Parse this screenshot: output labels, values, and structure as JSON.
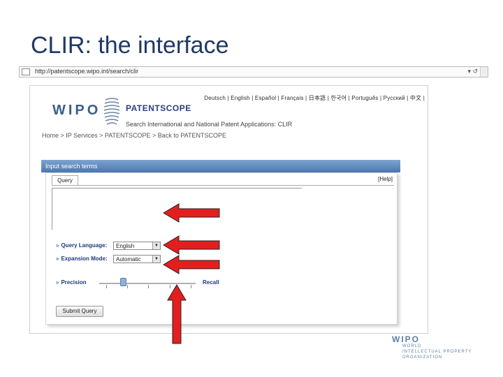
{
  "slide": {
    "title": "CLIR: the interface"
  },
  "browser": {
    "url": "http://patentscope.wipo.int/search/clir"
  },
  "site": {
    "language_links": "Deutsch | English | Español | Français | 日本語 | 한국어 | Português | Русский | 中文 |",
    "logo_text": "WIPO",
    "product_name": "PATENTSCOPE",
    "subtitle": "Search International and National Patent Applications: CLIR",
    "breadcrumb": "Home > IP Services > PATENTSCOPE > Back to PATENTSCOPE"
  },
  "search_form": {
    "header": "Input search terms",
    "tab_label": "Query",
    "help_link": "[Help]",
    "query_value": "",
    "query_language_label": "Query Language:",
    "query_language_value": "English",
    "expansion_mode_label": "Expansion Mode:",
    "expansion_mode_value": "Automatic",
    "precision_label": "Precision",
    "recall_label": "Recall",
    "precision_recall_level": 0.25,
    "submit_label": "Submit Query"
  },
  "footer": {
    "logo": "WIPO",
    "org_line1": "WORLD",
    "org_line2": "INTELLECTUAL PROPERTY",
    "org_line3": "ORGANIZATION"
  },
  "colors": {
    "arrow": "#e41e1e",
    "accent": "#1f3864"
  }
}
